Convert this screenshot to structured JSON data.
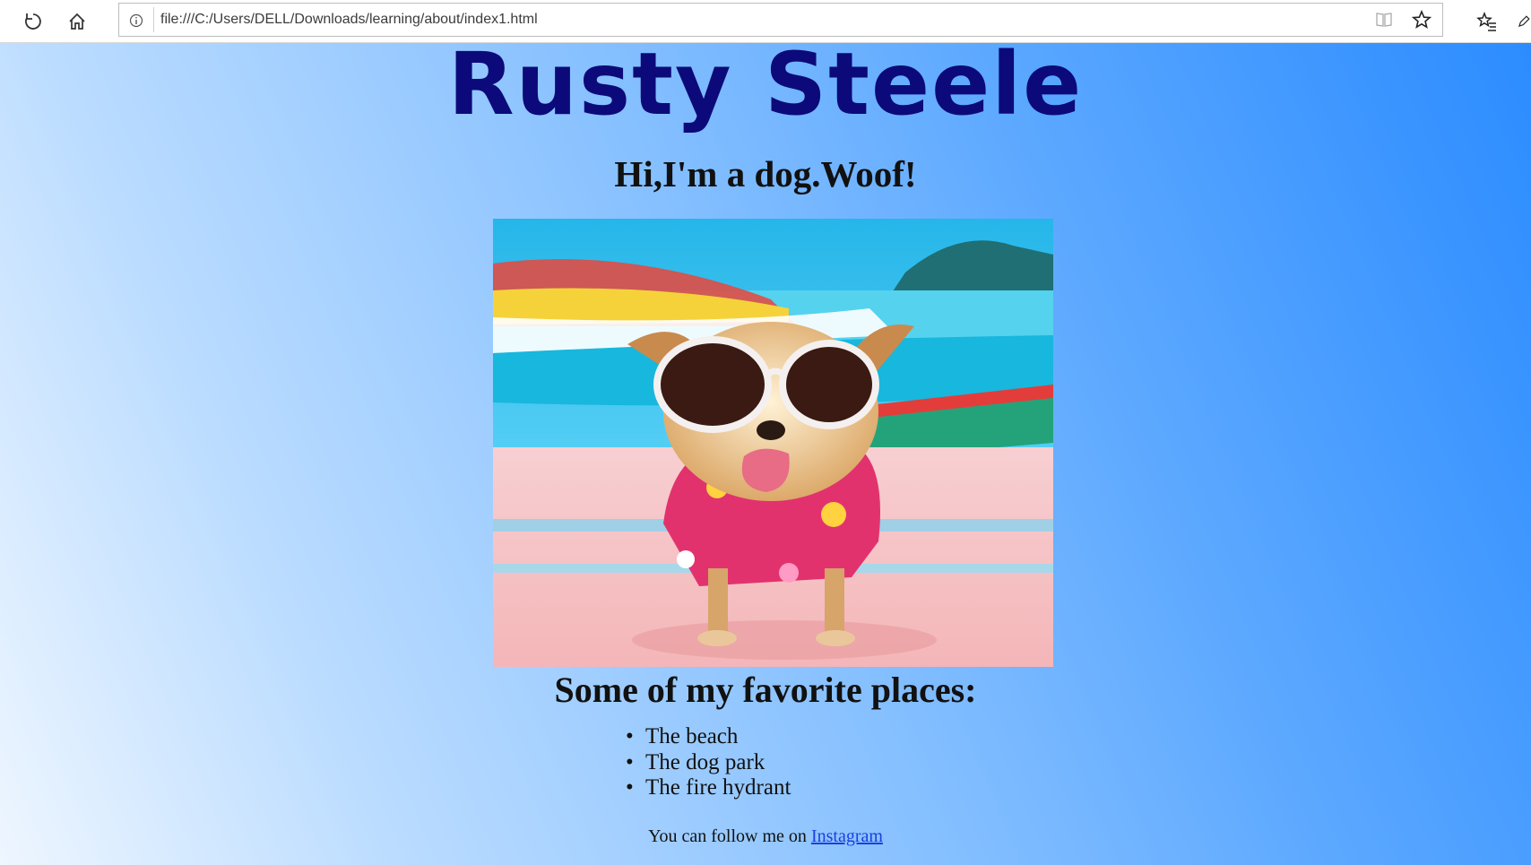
{
  "browser": {
    "url": "file:///C:/Users/DELL/Downloads/learning/about/index1.html",
    "icons": [
      "refresh-icon",
      "home-icon",
      "info-icon",
      "reading-view-icon",
      "star-icon",
      "favorites-icon",
      "pen-icon"
    ]
  },
  "page": {
    "title": "Rusty Steele",
    "tagline": "Hi,I'm a dog.Woof!",
    "photo_alt": "dog",
    "places_heading": "Some of my favorite places:",
    "places": [
      "The beach",
      "The dog park",
      "The fire hydrant"
    ],
    "follow_text": "You can follow me on ",
    "follow_link": "Instagram"
  }
}
